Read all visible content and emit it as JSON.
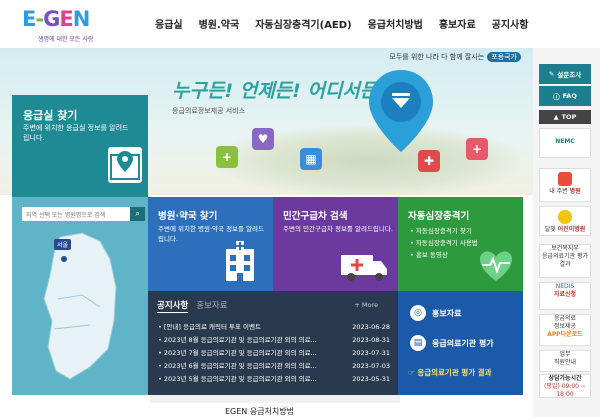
{
  "logo": {
    "text": "E-GEN",
    "tagline": "생명에 대한 모든 사랑",
    "colors": [
      "#2d9be0",
      "#6bbf3e",
      "#7b4ec4",
      "#e0418b"
    ]
  },
  "nav": [
    "응급실",
    "병원.약국",
    "자동심장충격기(AED)",
    "응급처치방법",
    "홍보자료",
    "공지사항"
  ],
  "hero": {
    "top_slogan": "모두를 위한 나라 다 함께 잘사는",
    "top_badge": "포용국가",
    "title": "누구든! 언제든! 어디서든!",
    "subtitle": "응급의료정보제공 서비스"
  },
  "er_find": {
    "title": "응급실 찾기",
    "desc": "주변에 위치한 응급실 정보를 알려드립니다.",
    "search_placeholder": "지역 선택 또는 병원명으로 검색",
    "seoul_label": "서울"
  },
  "services": [
    {
      "title": "병원·약국 찾기",
      "desc": "주변에 위치한 병원·약국 정보를 알려드립니다."
    },
    {
      "title": "민간구급차 검색",
      "desc": "주변의 민간구급차 정보를 알려드립니다."
    },
    {
      "title": "자동심장충격기",
      "items": [
        "자동심장충격기 찾기",
        "자동심장충격기 사용법",
        "홍보 동영상"
      ]
    }
  ],
  "notice": {
    "tab_active": "공지사항",
    "tab_inactive": "홍보자료",
    "more": "+ More",
    "items": [
      {
        "title": "[안내] 응급의료 캐릭터 투표 이벤트",
        "date": "2023-06-28"
      },
      {
        "title": "2023년 8월 응급의료기관 및 응급의료기관 외의 의료...",
        "date": "2023-08-31"
      },
      {
        "title": "2023년 7월 응급의료기관 및 응급의료기관 외의 의료...",
        "date": "2023-07-31"
      },
      {
        "title": "2023년 6월 응급의료기관 및 응급의료기관 외의 의료...",
        "date": "2023-07-03"
      },
      {
        "title": "2023년 5월 응급의료기관 및 응급의료기관 외의 의료...",
        "date": "2023-05-31"
      }
    ]
  },
  "right_blue": {
    "item1": "홍보자료",
    "item2": "응급의료기관 평가",
    "link": "☞ 응급의료기관 평가 결과"
  },
  "quick": {
    "survey": "설문조사",
    "faq": "FAQ",
    "top": "TOP",
    "nemc": "NEMC",
    "cards": [
      {
        "l1": "내 주변",
        "l2": "병원"
      },
      {
        "l1": "달빛",
        "l2": "어린이병원"
      },
      {
        "l1": "보건복지부",
        "l2": "응급의료기관 평가 결과"
      },
      {
        "l1": "NEDIS",
        "l2": "자료신청"
      },
      {
        "l1": "응급의료",
        "l2": "정보제공",
        "l3": "APP다운로드"
      },
      {
        "l1": "업무",
        "l2": "직원안내"
      },
      {
        "l1": "상담가능시간",
        "l2": "(평일) 09:00 ~ 18:00"
      }
    ]
  },
  "footer": {
    "text": "EGEN 응급처치방법"
  }
}
